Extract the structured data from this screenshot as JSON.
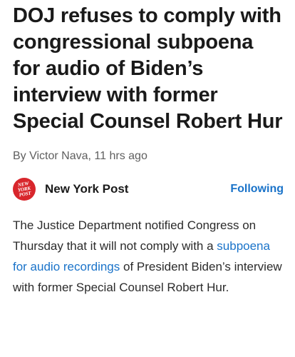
{
  "article": {
    "headline": "DOJ refuses to comply with congressional subpoena for audio of Biden’s interview with former Special Counsel Robert Hur",
    "byline": "By Victor Nava, 11 hrs ago",
    "publisher": {
      "name": "New York Post",
      "logo_lines": [
        "NEW",
        "YORK",
        "POST"
      ],
      "logo_color": "#d8262c",
      "follow_label": "Following"
    },
    "body": {
      "before_link": "The Justice Department notified Congress on Thursday that it will not comply with a ",
      "link_text": "subpoena for audio recordings",
      "after_link": " of President Biden’s interview with former Special Counsel Robert Hur."
    }
  },
  "colors": {
    "link": "#1a73c9",
    "byline": "#5f5f5f"
  }
}
